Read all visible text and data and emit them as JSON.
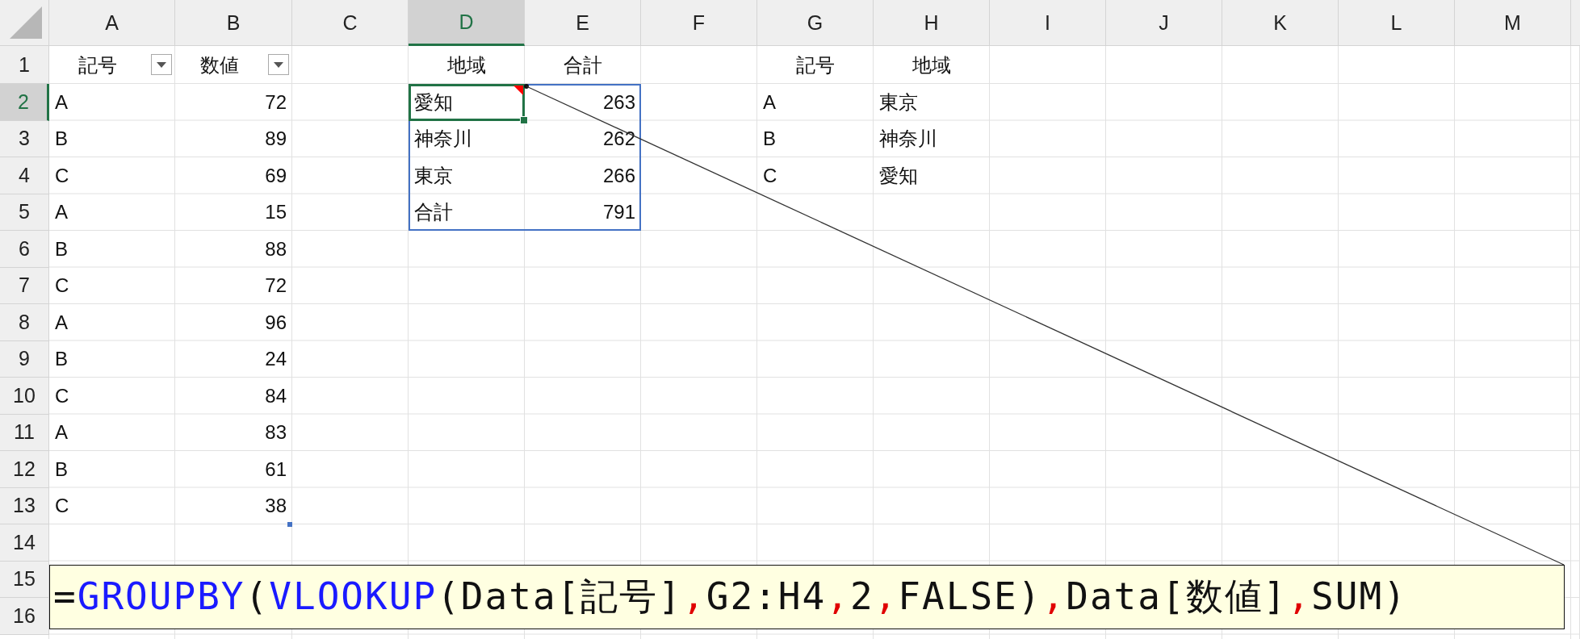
{
  "columns": [
    {
      "label": "A",
      "selected": false
    },
    {
      "label": "B",
      "selected": false
    },
    {
      "label": "C",
      "selected": false
    },
    {
      "label": "D",
      "selected": true
    },
    {
      "label": "E",
      "selected": false
    },
    {
      "label": "F",
      "selected": false
    },
    {
      "label": "G",
      "selected": false
    },
    {
      "label": "H",
      "selected": false
    },
    {
      "label": "I",
      "selected": false
    },
    {
      "label": "J",
      "selected": false
    },
    {
      "label": "K",
      "selected": false
    },
    {
      "label": "L",
      "selected": false
    },
    {
      "label": "M",
      "selected": false
    }
  ],
  "rows": [
    {
      "label": "1",
      "selected": false,
      "cells": [
        {
          "text": "記号",
          "kind": "heading",
          "filter": true
        },
        {
          "text": "数値",
          "kind": "heading",
          "filter": true
        },
        null,
        {
          "text": "地域",
          "kind": "heading"
        },
        {
          "text": "合計",
          "kind": "heading"
        },
        null,
        {
          "text": "記号",
          "kind": "heading"
        },
        {
          "text": "地域",
          "kind": "heading"
        }
      ]
    },
    {
      "label": "2",
      "selected": true,
      "cells": [
        {
          "text": "A",
          "kind": "text"
        },
        {
          "text": "72",
          "kind": "number"
        },
        null,
        {
          "text": "愛知",
          "kind": "text",
          "spill": true,
          "selected": true,
          "comment": true
        },
        {
          "text": "263",
          "kind": "number",
          "spill": true
        },
        null,
        {
          "text": "A",
          "kind": "text"
        },
        {
          "text": "東京",
          "kind": "text"
        }
      ]
    },
    {
      "label": "3",
      "selected": false,
      "cells": [
        {
          "text": "B",
          "kind": "text"
        },
        {
          "text": "89",
          "kind": "number"
        },
        null,
        {
          "text": "神奈川",
          "kind": "text",
          "spill": true
        },
        {
          "text": "262",
          "kind": "number",
          "spill": true
        },
        null,
        {
          "text": "B",
          "kind": "text"
        },
        {
          "text": "神奈川",
          "kind": "text"
        }
      ]
    },
    {
      "label": "4",
      "selected": false,
      "cells": [
        {
          "text": "C",
          "kind": "text"
        },
        {
          "text": "69",
          "kind": "number"
        },
        null,
        {
          "text": "東京",
          "kind": "text",
          "spill": true
        },
        {
          "text": "266",
          "kind": "number",
          "spill": true
        },
        null,
        {
          "text": "C",
          "kind": "text"
        },
        {
          "text": "愛知",
          "kind": "text"
        }
      ]
    },
    {
      "label": "5",
      "selected": false,
      "cells": [
        {
          "text": "A",
          "kind": "text"
        },
        {
          "text": "15",
          "kind": "number"
        },
        null,
        {
          "text": "合計",
          "kind": "text",
          "spill": true
        },
        {
          "text": "791",
          "kind": "number",
          "spill": true
        }
      ]
    },
    {
      "label": "6",
      "selected": false,
      "cells": [
        {
          "text": "B",
          "kind": "text"
        },
        {
          "text": "88",
          "kind": "number"
        }
      ]
    },
    {
      "label": "7",
      "selected": false,
      "cells": [
        {
          "text": "C",
          "kind": "text"
        },
        {
          "text": "72",
          "kind": "number"
        }
      ]
    },
    {
      "label": "8",
      "selected": false,
      "cells": [
        {
          "text": "A",
          "kind": "text"
        },
        {
          "text": "96",
          "kind": "number"
        }
      ]
    },
    {
      "label": "9",
      "selected": false,
      "cells": [
        {
          "text": "B",
          "kind": "text"
        },
        {
          "text": "24",
          "kind": "number"
        }
      ]
    },
    {
      "label": "10",
      "selected": false,
      "cells": [
        {
          "text": "C",
          "kind": "text"
        },
        {
          "text": "84",
          "kind": "number"
        }
      ]
    },
    {
      "label": "11",
      "selected": false,
      "cells": [
        {
          "text": "A",
          "kind": "text"
        },
        {
          "text": "83",
          "kind": "number"
        }
      ]
    },
    {
      "label": "12",
      "selected": false,
      "cells": [
        {
          "text": "B",
          "kind": "text"
        },
        {
          "text": "61",
          "kind": "number"
        }
      ]
    },
    {
      "label": "13",
      "selected": false,
      "cells": [
        {
          "text": "C",
          "kind": "text"
        },
        {
          "text": "38",
          "kind": "number",
          "resize_handle": true
        }
      ]
    },
    {
      "label": "14",
      "selected": false,
      "cells": []
    },
    {
      "label": "15",
      "selected": false,
      "cells": []
    },
    {
      "label": "16",
      "selected": false,
      "cells": []
    }
  ],
  "callout": {
    "formula": [
      {
        "text": "=",
        "kind": "plain"
      },
      {
        "text": "GROUPBY",
        "kind": "function"
      },
      {
        "text": "(",
        "kind": "plain"
      },
      {
        "text": "VLOOKUP",
        "kind": "function"
      },
      {
        "text": "(Data[記号]",
        "kind": "plain"
      },
      {
        "text": ",",
        "kind": "separator"
      },
      {
        "text": "G2:H4",
        "kind": "plain"
      },
      {
        "text": ",",
        "kind": "separator"
      },
      {
        "text": "2",
        "kind": "plain"
      },
      {
        "text": ",",
        "kind": "separator"
      },
      {
        "text": "FALSE)",
        "kind": "plain"
      },
      {
        "text": ",",
        "kind": "separator"
      },
      {
        "text": "Data[数値]",
        "kind": "plain"
      },
      {
        "text": ",",
        "kind": "separator"
      },
      {
        "text": "SUM)",
        "kind": "plain"
      }
    ]
  }
}
